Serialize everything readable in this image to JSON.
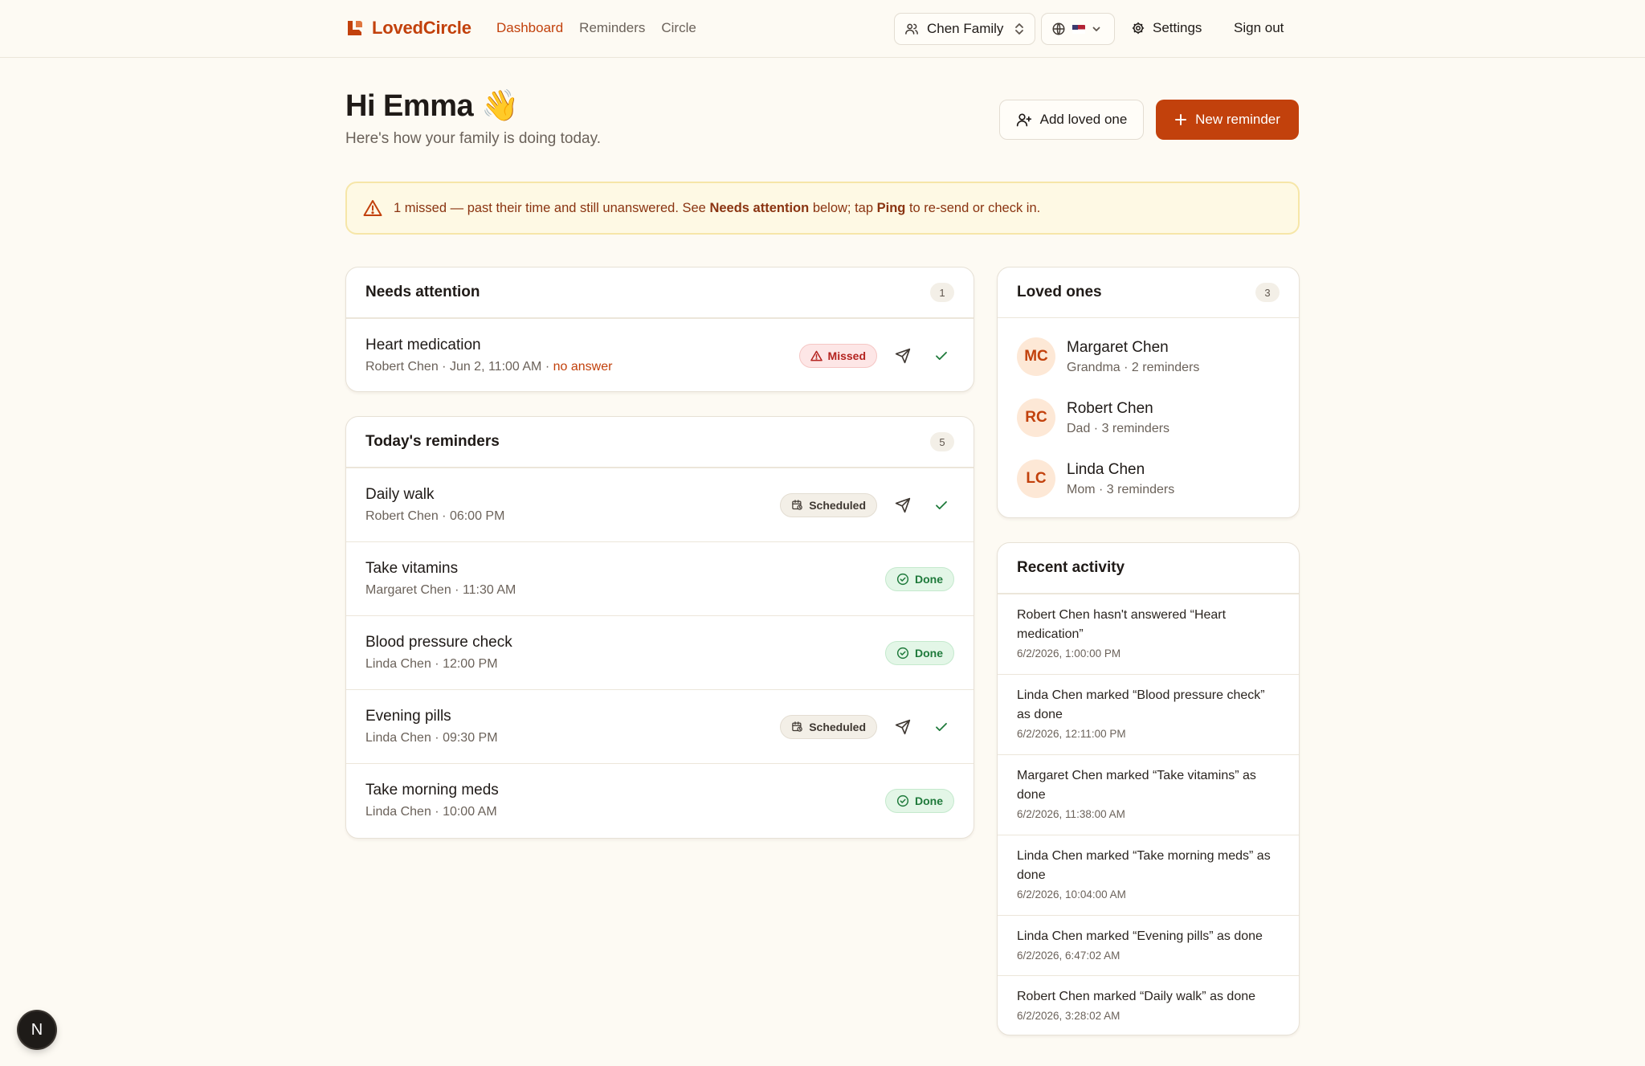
{
  "app": {
    "name": "LovedCircle"
  },
  "nav": {
    "dashboard": "Dashboard",
    "reminders": "Reminders",
    "circle": "Circle"
  },
  "topbar": {
    "family": "Chen Family",
    "settings": "Settings",
    "signout": "Sign out"
  },
  "greeting": {
    "title": "Hi Emma 👋",
    "subtitle": "Here's how your family is doing today."
  },
  "actions": {
    "add_loved_one": "Add loved one",
    "new_reminder": "New reminder"
  },
  "alert": {
    "prefix": "1 missed — past their time and still unanswered. See ",
    "bold1": "Needs attention",
    "middle": " below; tap ",
    "bold2": "Ping",
    "suffix": " to re-send or check in."
  },
  "needs_attention": {
    "title": "Needs attention",
    "count": "1",
    "items": [
      {
        "title": "Heart medication",
        "meta": "Robert Chen · Jun 2, 11:00 AM · ",
        "meta_warn": "no answer",
        "status": "Missed"
      }
    ]
  },
  "today": {
    "title": "Today's reminders",
    "count": "5",
    "items": [
      {
        "title": "Daily walk",
        "meta": "Robert Chen · 06:00 PM",
        "status": "Scheduled"
      },
      {
        "title": "Take vitamins",
        "meta": "Margaret Chen · 11:30 AM",
        "status": "Done"
      },
      {
        "title": "Blood pressure check",
        "meta": "Linda Chen · 12:00 PM",
        "status": "Done"
      },
      {
        "title": "Evening pills",
        "meta": "Linda Chen · 09:30 PM",
        "status": "Scheduled"
      },
      {
        "title": "Take morning meds",
        "meta": "Linda Chen · 10:00 AM",
        "status": "Done"
      }
    ]
  },
  "loved_ones": {
    "title": "Loved ones",
    "count": "3",
    "people": [
      {
        "initials": "MC",
        "name": "Margaret Chen",
        "meta": "Grandma · 2 reminders"
      },
      {
        "initials": "RC",
        "name": "Robert Chen",
        "meta": "Dad · 3 reminders"
      },
      {
        "initials": "LC",
        "name": "Linda Chen",
        "meta": "Mom · 3 reminders"
      }
    ]
  },
  "activity": {
    "title": "Recent activity",
    "items": [
      {
        "text": "Robert Chen hasn't answered “Heart medication”",
        "time": "6/2/2026, 1:00:00 PM"
      },
      {
        "text": "Linda Chen marked “Blood pressure check” as done",
        "time": "6/2/2026, 12:11:00 PM"
      },
      {
        "text": "Margaret Chen marked “Take vitamins” as done",
        "time": "6/2/2026, 11:38:00 AM"
      },
      {
        "text": "Linda Chen marked “Take morning meds” as done",
        "time": "6/2/2026, 10:04:00 AM"
      },
      {
        "text": "Linda Chen marked “Evening pills” as done",
        "time": "6/2/2026, 6:47:02 AM"
      },
      {
        "text": "Robert Chen marked “Daily walk” as done",
        "time": "6/2/2026, 3:28:02 AM"
      }
    ]
  },
  "dev_badge": "N",
  "colors": {
    "accent": "#c2410c",
    "background": "#fdfaf3",
    "missed": "#b4231f",
    "done": "#1f7a3b",
    "alert_bg": "#fef9e4"
  }
}
